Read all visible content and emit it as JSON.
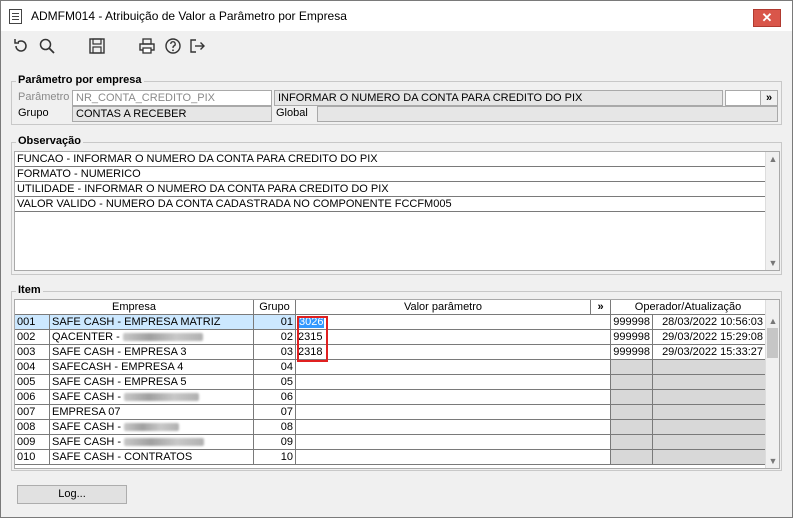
{
  "window": {
    "title": "ADMFM014 - Atribuição de Valor a Parâmetro por Empresa",
    "close_label": "✕"
  },
  "toolbar": {
    "icons": [
      "refresh-icon",
      "search-icon",
      "save-icon",
      "print-icon",
      "help-icon",
      "exit-icon"
    ]
  },
  "param_group": {
    "legend": "Parâmetro por empresa",
    "param_label": "Parâmetro",
    "param_value": "NR_CONTA_CREDITO_PIX",
    "param_desc": "INFORMAR O NUMERO DA CONTA PARA CREDITO DO PIX",
    "expand_label": "»",
    "grupo_label": "Grupo",
    "grupo_value": "CONTAS A RECEBER",
    "scope_value": "Global"
  },
  "obs_group": {
    "legend": "Observação",
    "lines": [
      "FUNCAO - INFORMAR O NUMERO DA CONTA PARA CREDITO DO PIX",
      "FORMATO - NUMERICO",
      "UTILIDADE - INFORMAR O NUMERO DA CONTA PARA CREDITO DO PIX",
      "VALOR VALIDO - NUMERO DA CONTA CADASTRADA NO COMPONENTE FCCFM005"
    ]
  },
  "item_group": {
    "legend": "Item",
    "headers": {
      "empresa": "Empresa",
      "grupo": "Grupo",
      "valor": "Valor parâmetro",
      "expand": "»",
      "operador": "Operador/Atualização"
    },
    "rows": [
      {
        "code": "001",
        "name": "SAFE CASH - EMPRESA MATRIZ",
        "grupo": "01",
        "valor": "3026",
        "operador": "999998",
        "data": "28/03/2022 10:56:03"
      },
      {
        "code": "002",
        "name": "QACENTER - ",
        "grupo": "02",
        "valor": "2315",
        "operador": "999998",
        "data": "29/03/2022 15:29:08"
      },
      {
        "code": "003",
        "name": "SAFE CASH -  EMPRESA 3",
        "grupo": "03",
        "valor": "2318",
        "operador": "999998",
        "data": "29/03/2022 15:33:27"
      },
      {
        "code": "004",
        "name": "SAFECASH -  EMPRESA 4",
        "grupo": "04",
        "valor": "",
        "operador": "",
        "data": ""
      },
      {
        "code": "005",
        "name": "SAFE CASH -  EMPRESA 5",
        "grupo": "05",
        "valor": "",
        "operador": "",
        "data": ""
      },
      {
        "code": "006",
        "name": "SAFE CASH - ",
        "grupo": "06",
        "valor": "",
        "operador": "",
        "data": ""
      },
      {
        "code": "007",
        "name": "EMPRESA 07",
        "grupo": "07",
        "valor": "",
        "operador": "",
        "data": ""
      },
      {
        "code": "008",
        "name": "SAFE CASH - ",
        "grupo": "08",
        "valor": "",
        "operador": "",
        "data": ""
      },
      {
        "code": "009",
        "name": "SAFE CASH - ",
        "grupo": "09",
        "valor": "",
        "operador": "",
        "data": ""
      },
      {
        "code": "010",
        "name": "SAFE CASH - CONTRATOS",
        "grupo": "10",
        "valor": "",
        "operador": "",
        "data": ""
      }
    ]
  },
  "footer": {
    "log_label": "Log..."
  }
}
